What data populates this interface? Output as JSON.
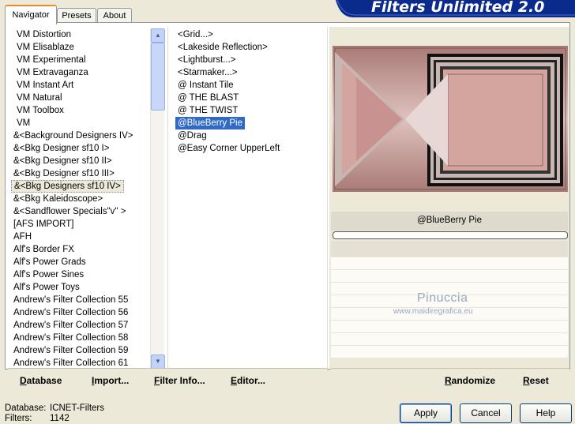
{
  "app": {
    "title": "Filters Unlimited 2.0"
  },
  "tabs": [
    {
      "label": "Navigator",
      "active": true
    },
    {
      "label": "Presets",
      "active": false
    },
    {
      "label": "About",
      "active": false
    }
  ],
  "categories": [
    "VM Distortion",
    "VM Elisablaze",
    "VM Experimental",
    "VM Extravaganza",
    "VM Instant Art",
    "VM Natural",
    "VM Toolbox",
    "VM",
    "&<Background Designers IV>",
    "&<Bkg Designer sf10 I>",
    "&<Bkg Designer sf10 II>",
    "&<Bkg Designer sf10 III>",
    "&<Bkg Designers sf10 IV>",
    "&<Bkg Kaleidoscope>",
    "&<Sandflower Specials\"v\" >",
    "[AFS IMPORT]",
    "AFH",
    "Alf's Border FX",
    "Alf's Power Grads",
    "Alf's Power Sines",
    "Alf's Power Toys",
    "Andrew's Filter Collection 55",
    "Andrew's Filter Collection 56",
    "Andrew's Filter Collection 57",
    "Andrew's Filter Collection 58",
    "Andrew's Filter Collection 59",
    "Andrew's Filter Collection 61"
  ],
  "selected_category": "&<Bkg Designers sf10 IV>",
  "filters": [
    "<Grid...>",
    "<Lakeside Reflection>",
    "<Lightburst...>",
    "<Starmaker...>",
    "@ Instant Tile",
    "@ THE BLAST",
    "@ THE TWIST",
    "@BlueBerry Pie",
    "@Drag",
    "@Easy Corner UpperLeft"
  ],
  "selected_filter": "@BlueBerry Pie",
  "preview": {
    "filter_name": "@BlueBerry Pie",
    "watermark_name": "Pinuccia",
    "watermark_url": "www.maidiregrafica.eu"
  },
  "toolbar": {
    "database": "Database",
    "import": "Import...",
    "filter_info": "Filter Info...",
    "editor": "Editor...",
    "randomize": "Randomize",
    "reset": "Reset"
  },
  "status": {
    "database_label": "Database:",
    "database_value": "ICNET-Filters",
    "filters_label": "Filters:",
    "filters_value": "1142"
  },
  "buttons": {
    "apply": "Apply",
    "cancel": "Cancel",
    "help": "Help"
  },
  "colors": {
    "banner": "#0a2a8c",
    "selection": "#316ac5",
    "preview_pink": "#d4a49f"
  }
}
